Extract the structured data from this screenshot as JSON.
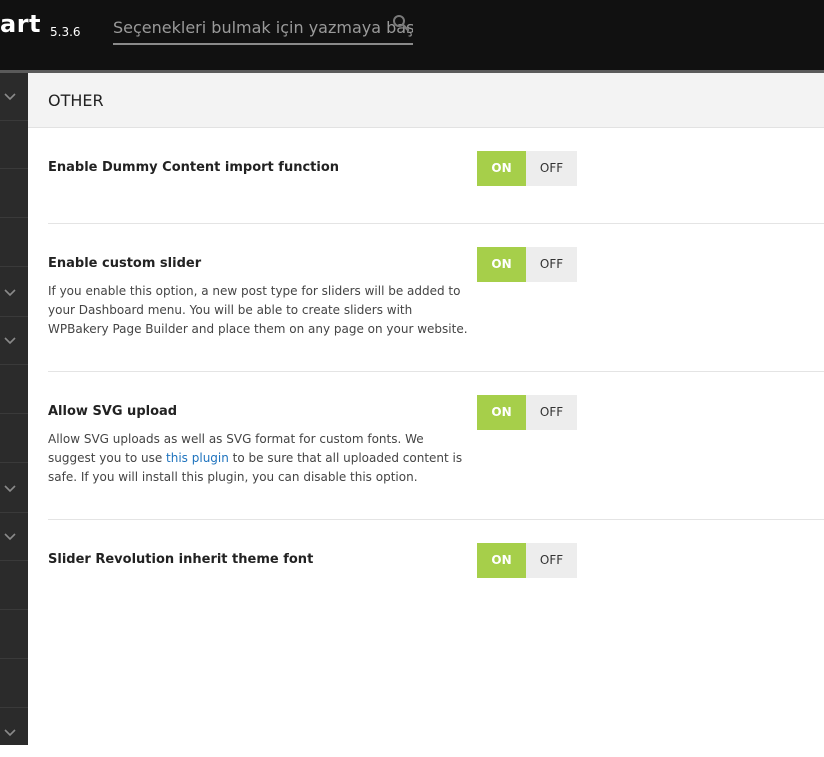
{
  "header": {
    "brand": "art",
    "version": "5.3.6",
    "search_placeholder": "Seçenekleri bulmak için yazmaya baş"
  },
  "section": {
    "title": "OTHER"
  },
  "options": [
    {
      "label": "Enable Dummy Content import function",
      "on_label": "ON",
      "off_label": "OFF",
      "state": "on"
    },
    {
      "label": "Enable custom slider",
      "description": "If you enable this option, a new post type for sliders will be added to your Dashboard menu. You will be able to create sliders with WPBakery Page Builder and place them on any page on your website.",
      "on_label": "ON",
      "off_label": "OFF",
      "state": "on"
    },
    {
      "label": "Allow SVG upload",
      "description_pre": "Allow SVG uploads as well as SVG format for custom fonts. We suggest you to use ",
      "description_link": "this plugin",
      "description_post": " to be sure that all uploaded content is safe. If you will install this plugin, you can disable this option.",
      "on_label": "ON",
      "off_label": "OFF",
      "state": "on"
    },
    {
      "label": "Slider Revolution inherit theme font",
      "on_label": "ON",
      "off_label": "OFF",
      "state": "on"
    }
  ],
  "colors": {
    "toggle_on": "#a6cf4a",
    "toggle_off": "#ededed",
    "link": "#1e73be",
    "topbar": "#111111",
    "sidebar": "#2b2b2b"
  },
  "sidebar": {
    "items": [
      {
        "icon": "chevron-down-icon"
      },
      {
        "icon": "none"
      },
      {
        "icon": "none"
      },
      {
        "icon": "none"
      },
      {
        "icon": "chevron-down-icon"
      },
      {
        "icon": "chevron-down-icon"
      },
      {
        "icon": "none"
      },
      {
        "icon": "none"
      },
      {
        "icon": "chevron-down-icon"
      },
      {
        "icon": "chevron-down-icon"
      },
      {
        "icon": "none"
      },
      {
        "icon": "none"
      },
      {
        "icon": "none"
      },
      {
        "icon": "chevron-down-icon"
      }
    ]
  }
}
